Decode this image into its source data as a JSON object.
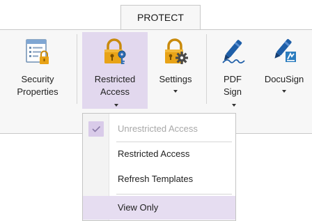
{
  "tab": {
    "label": "PROTECT"
  },
  "ribbon": {
    "security_properties": {
      "line1": "Security",
      "line2": "Properties"
    },
    "restricted_access": {
      "line1": "Restricted",
      "line2": "Access"
    },
    "settings": {
      "line1": "Settings"
    },
    "pdf_sign": {
      "line1": "PDF",
      "line2": "Sign"
    },
    "docusign": {
      "line1": "DocuSign"
    }
  },
  "menu": {
    "items": [
      {
        "label": "Unrestricted Access",
        "checked": true,
        "disabled": true
      },
      {
        "label": "Restricted Access"
      },
      {
        "label": "Refresh Templates"
      },
      {
        "label": "View Only",
        "highlighted": true
      }
    ]
  },
  "colors": {
    "active_button": "#e2d8ee",
    "lock_gold": "#e8a317",
    "pen_blue": "#1f5fa8",
    "docusign_blue": "#2c7dbf"
  },
  "icons": [
    "security-properties-icon",
    "lock-key-icon",
    "lock-gear-icon",
    "pen-sign-icon",
    "docusign-pen-icon",
    "checkmark-icon"
  ]
}
